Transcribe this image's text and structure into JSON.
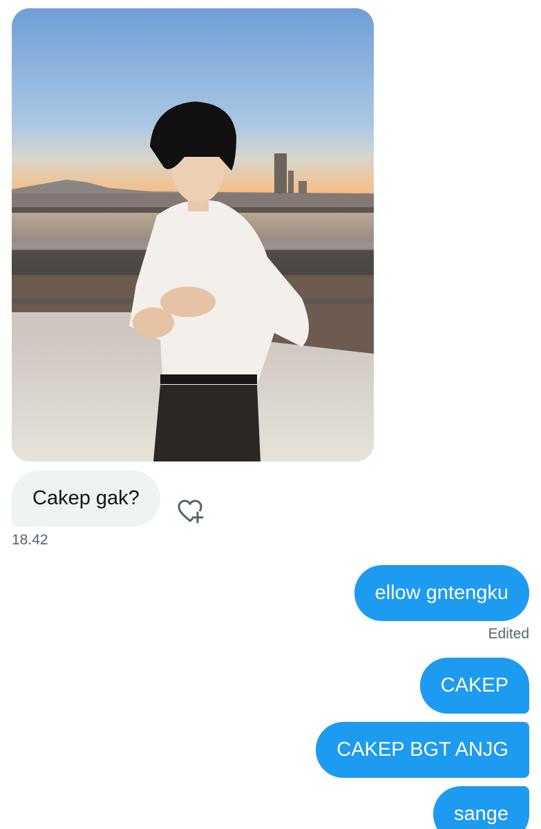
{
  "received": {
    "photo_alt": "",
    "text": "Cakep gak?",
    "time": "18.42",
    "react_icon": "heart-plus-icon"
  },
  "sent": {
    "messages": [
      {
        "text": "ellow gntengku",
        "status": "Edited"
      },
      {
        "text": "CAKEP"
      },
      {
        "text": "CAKEP BGT ANJG"
      },
      {
        "text": "sange"
      }
    ]
  },
  "colors": {
    "sent_bubble": "#1d9bf0",
    "received_bubble": "#eff3f4",
    "meta_text": "#536471"
  }
}
